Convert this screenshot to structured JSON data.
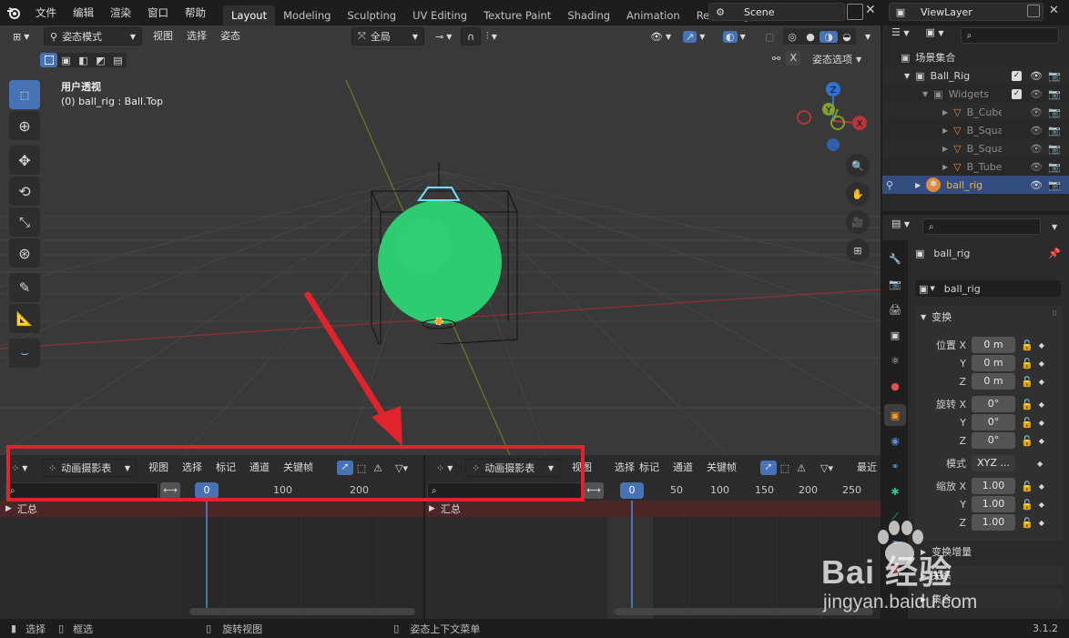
{
  "app": {
    "menus": [
      "文件",
      "编辑",
      "渲染",
      "窗口",
      "帮助"
    ],
    "workspace_tabs": [
      "Layout",
      "Modeling",
      "Sculpting",
      "UV Editing",
      "Texture Paint",
      "Shading",
      "Animation",
      "Rendering"
    ],
    "active_tab": "Layout",
    "scene_name": "Scene",
    "view_layer": "ViewLayer",
    "version": "3.1.2"
  },
  "viewport": {
    "mode": "姿态模式",
    "menu_view": "视图",
    "menu_select": "选择",
    "menu_pose": "姿态",
    "transform_orientation": "全局",
    "pose_options": "姿态选项",
    "x_label": "X",
    "overlay_title": "用户透视",
    "overlay_object": "(0) ball_rig : Ball.Top",
    "gizmo": {
      "x": "X",
      "y": "Y",
      "z": "Z"
    },
    "colors": {
      "ball": "#2ecc71",
      "x_axis": "#b8353c",
      "y_axis": "#7ea22a",
      "z_axis": "#2f72d6",
      "selection": "#4772b3"
    }
  },
  "timeline_left": {
    "editor_type": "动画摄影表",
    "menus": [
      "视图",
      "选择",
      "标记",
      "通道",
      "关键帧"
    ],
    "current_frame": "0",
    "ticks": [
      "100",
      "200"
    ],
    "summary": "汇总"
  },
  "timeline_right": {
    "editor_type": "动画摄影表",
    "menus": [
      "视图",
      "选择",
      "标记",
      "通道",
      "关键帧"
    ],
    "extra": "最近",
    "current_frame": "0",
    "ticks": [
      "50",
      "100",
      "150",
      "200",
      "250"
    ],
    "summary": "汇总"
  },
  "outliner": {
    "root": "场景集合",
    "items": [
      {
        "name": "Ball_Rig",
        "type": "collection"
      },
      {
        "name": "Widgets",
        "type": "collection"
      },
      {
        "name": "B_Cube",
        "type": "mesh"
      },
      {
        "name": "B_Squa",
        "type": "mesh"
      },
      {
        "name": "B_Squa",
        "type": "mesh"
      },
      {
        "name": "B_Tube",
        "type": "mesh"
      },
      {
        "name": "ball_rig",
        "type": "armature"
      }
    ]
  },
  "properties": {
    "object_name": "ball_rig",
    "data_name": "ball_rig",
    "section_transform": "变换",
    "location_label": "位置 X",
    "rotation_label": "旋转 X",
    "scale_label": "缩放 X",
    "y_label": "Y",
    "z_label": "Z",
    "location": [
      "0 m",
      "0 m",
      "0 m"
    ],
    "rotation": [
      "0°",
      "0°",
      "0°"
    ],
    "mode_label": "模式",
    "mode_value": "XYZ ...",
    "scale": [
      "1.00",
      "1.00",
      "1.00"
    ],
    "section_delta": "变换增量",
    "section_relations": "关系",
    "section_collections": "集合"
  },
  "statusbar": {
    "select": "选择",
    "box_select": "框选",
    "rotate_view": "旋转视图",
    "context_menu": "姿态上下文菜单"
  },
  "annotation": {
    "color": "#e0232c"
  },
  "watermark": {
    "text_top": "Bai 经验",
    "text_bottom": "jingyan.baidu.com"
  }
}
